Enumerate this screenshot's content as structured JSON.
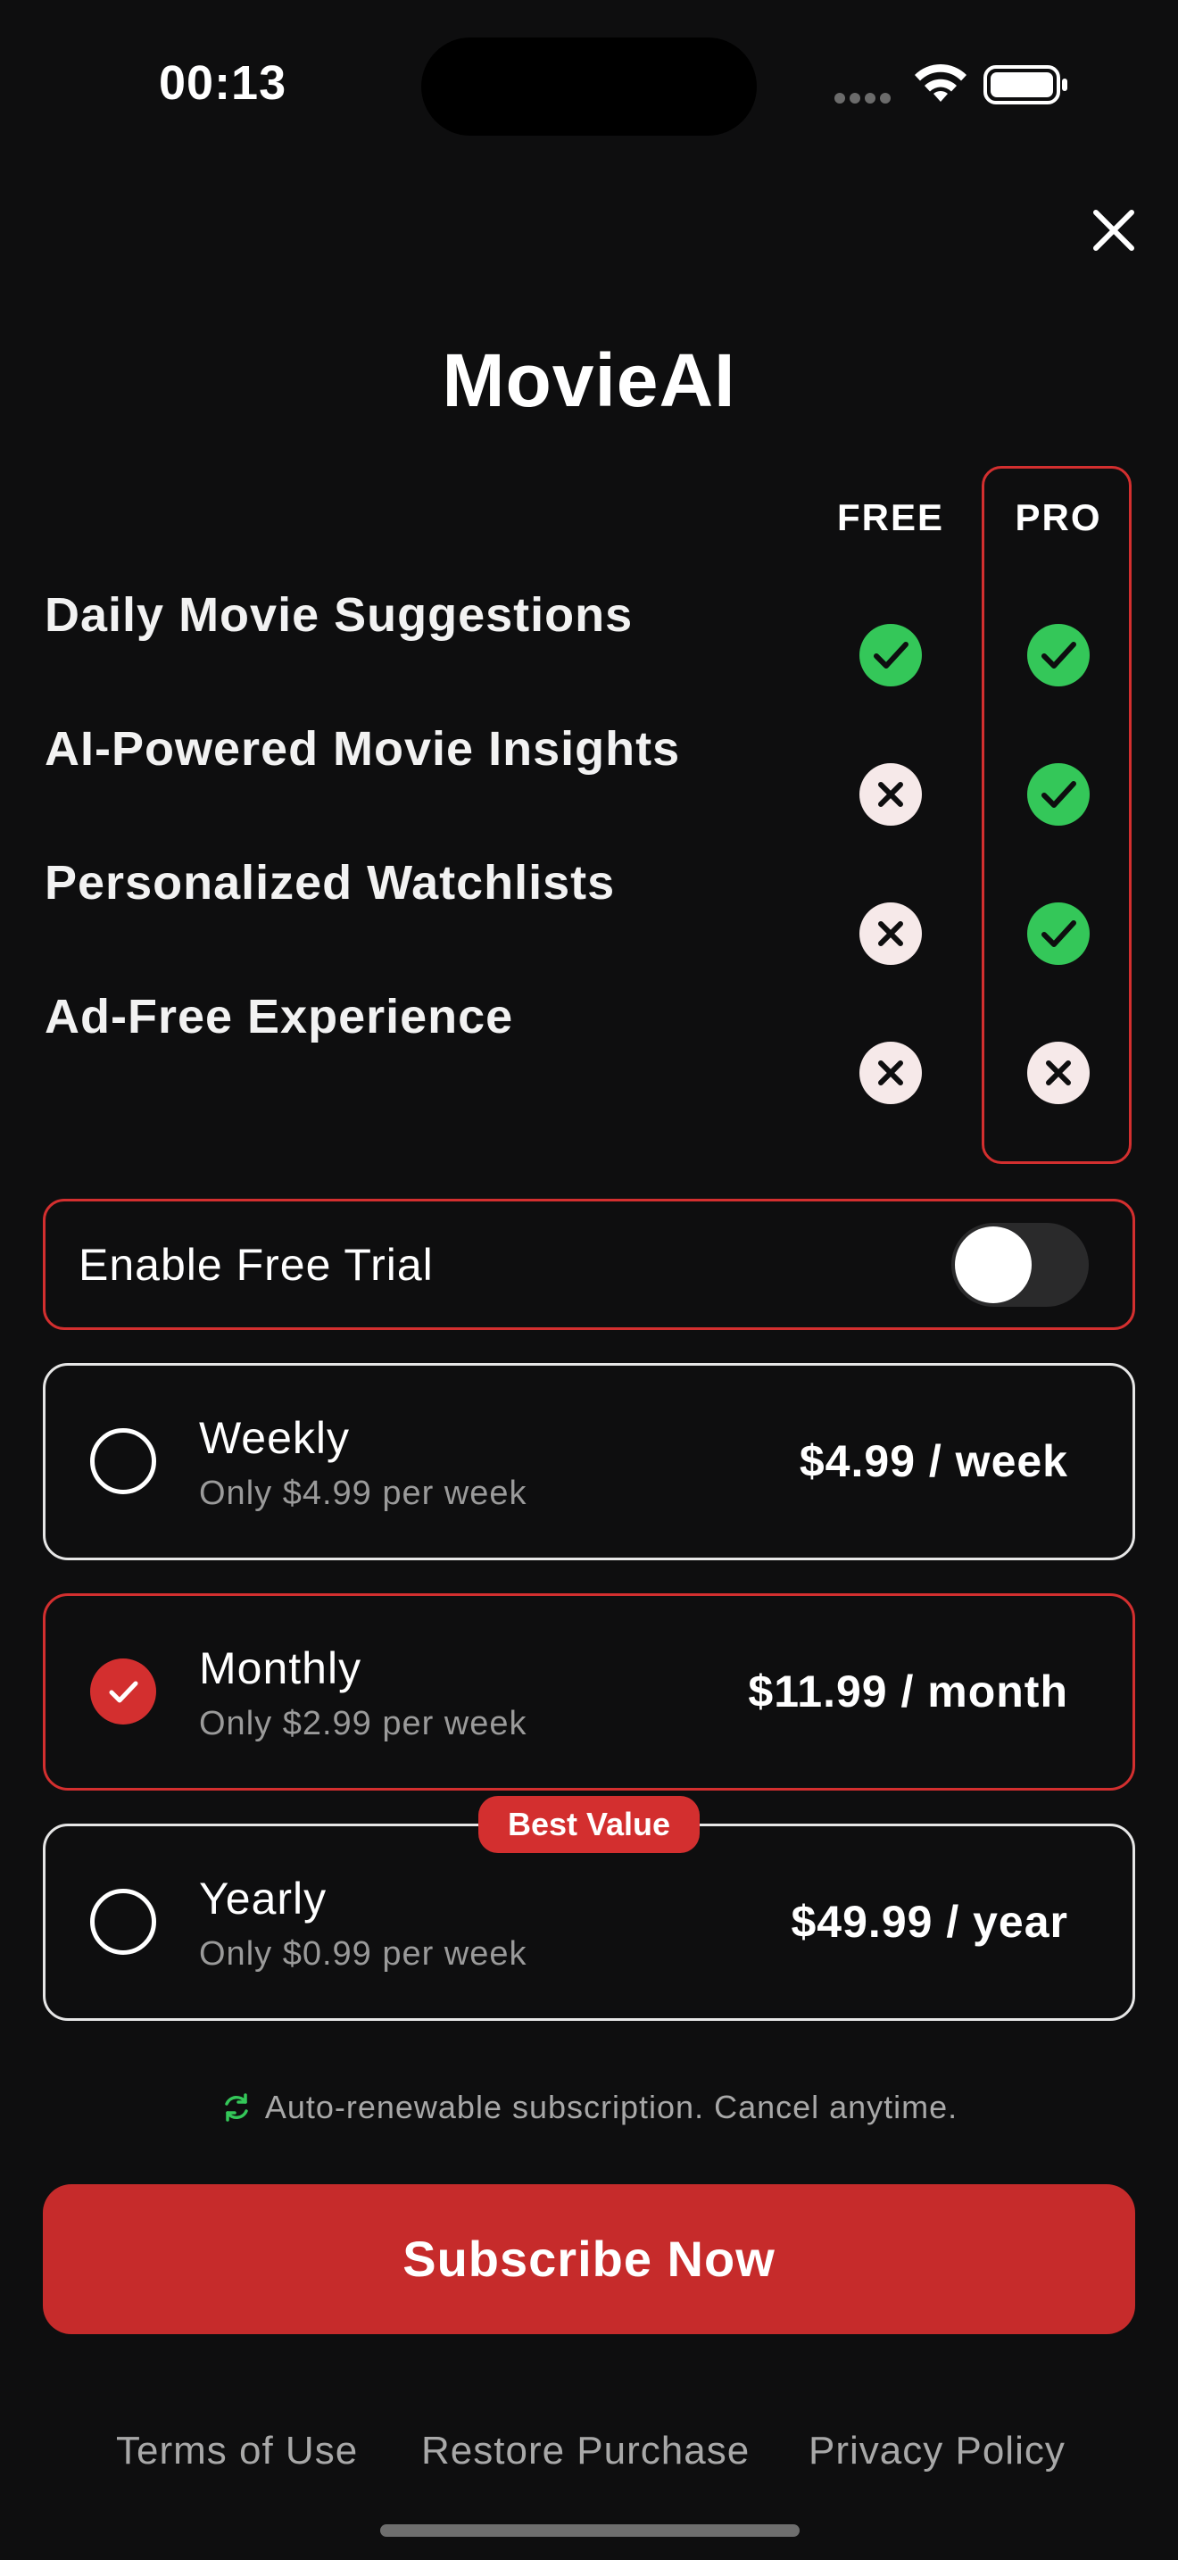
{
  "status_bar": {
    "time": "00:13"
  },
  "header": {
    "app_title": "MovieAI",
    "close_icon": "close-icon"
  },
  "comparison": {
    "free_label": "FREE",
    "pro_label": "PRO",
    "features": [
      {
        "label": "Daily Movie Suggestions",
        "free": true,
        "pro": true
      },
      {
        "label": "AI-Powered Movie Insights",
        "free": false,
        "pro": true
      },
      {
        "label": "Personalized Watchlists",
        "free": false,
        "pro": true
      },
      {
        "label": "Ad-Free Experience",
        "free": false,
        "pro": false
      }
    ]
  },
  "trial": {
    "label": "Enable Free Trial",
    "enabled": false
  },
  "plans": [
    {
      "name": "Weekly",
      "subtitle": "Only $4.99 per week",
      "price": "$4.99 / week",
      "selected": false
    },
    {
      "name": "Monthly",
      "subtitle": "Only $2.99 per week",
      "price": "$11.99 / month",
      "selected": true
    },
    {
      "name": "Yearly",
      "subtitle": "Only $0.99 per week",
      "price": "$49.99 / year",
      "selected": false,
      "badge": "Best Value"
    }
  ],
  "renewal_note": "Auto-renewable subscription. Cancel anytime.",
  "cta": {
    "label": "Subscribe Now"
  },
  "footer": {
    "terms": "Terms of Use",
    "restore": "Restore Purchase",
    "privacy": "Privacy Policy"
  },
  "colors": {
    "accent": "#d32f2f",
    "check_green": "#34c759",
    "background": "#0e0e0f"
  }
}
